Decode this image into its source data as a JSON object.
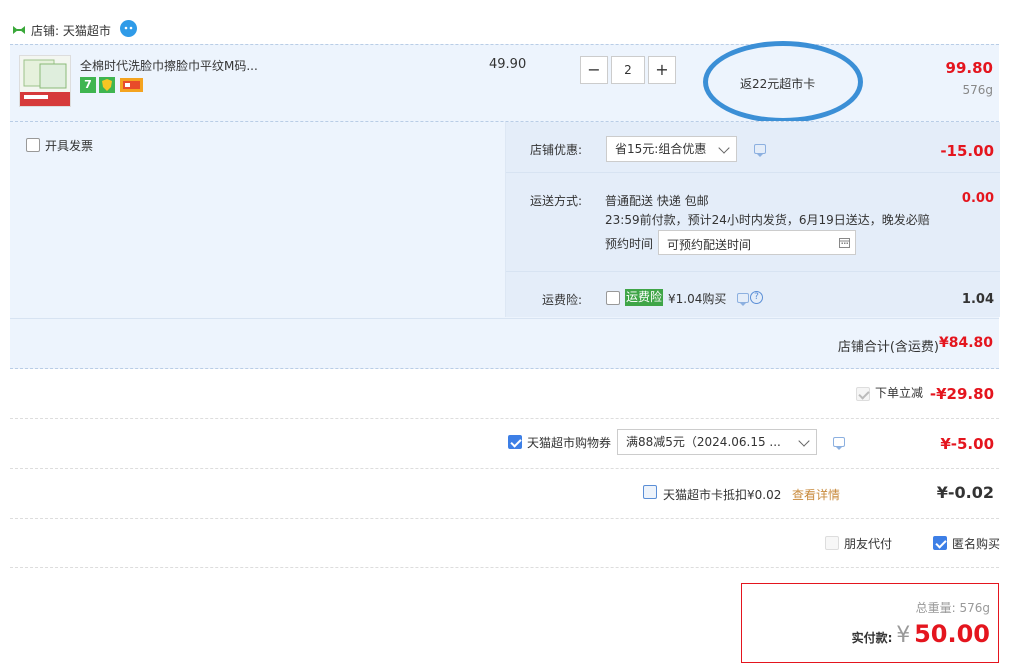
{
  "store": {
    "label": "店铺: 天猫超市"
  },
  "item": {
    "title": "全棉时代洗脸巾擦脸巾平纹M码...",
    "unit_price": "49.90",
    "quantity": "2",
    "minus": "−",
    "plus": "+",
    "rebate": "返22元超市卡",
    "subtotal": "99.80",
    "weight": "576g",
    "badges": [
      "7",
      "shield",
      "card"
    ]
  },
  "invoice": {
    "label": "开具发票"
  },
  "discount": {
    "label": "店铺优惠:",
    "selected": "省15元:组合优惠",
    "amount": "-15.00"
  },
  "shipping": {
    "label": "运送方式:",
    "method": "普通配送 快递 包邮",
    "detail": "23:59前付款，预计24小时内发货，6月19日送达，晚发必赔",
    "appointment_label": "预约时间",
    "appointment_value": "可预约配送时间",
    "amount": "0.00"
  },
  "insurance": {
    "label": "运费险:",
    "tag": "运费险",
    "price": "¥1.04购买",
    "amount": "1.04"
  },
  "store_total": {
    "label": "店铺合计(含运费)",
    "amount": "¥84.80"
  },
  "instant": {
    "label": "下单立减",
    "amount": "-¥29.80"
  },
  "coupon": {
    "label": "天猫超市购物券",
    "selected": "满88减5元（2024.06.15 ...",
    "amount": "¥-5.00"
  },
  "card": {
    "label": "天猫超市卡抵扣¥0.02",
    "link": "查看详情",
    "amount": "¥-0.02"
  },
  "options": {
    "friend_pay": "朋友代付",
    "anonymous": "匿名购买"
  },
  "summary": {
    "weight_label": "总重量:",
    "weight": "576g",
    "pay_label": "实付款:",
    "currency": "¥",
    "pay_amount": "50.00"
  },
  "colors": {
    "accent": "#e4151e",
    "highlight_bg": "#edf4fd",
    "annotation": "#3b8fd6",
    "insurance_tag": "#3fa547"
  }
}
